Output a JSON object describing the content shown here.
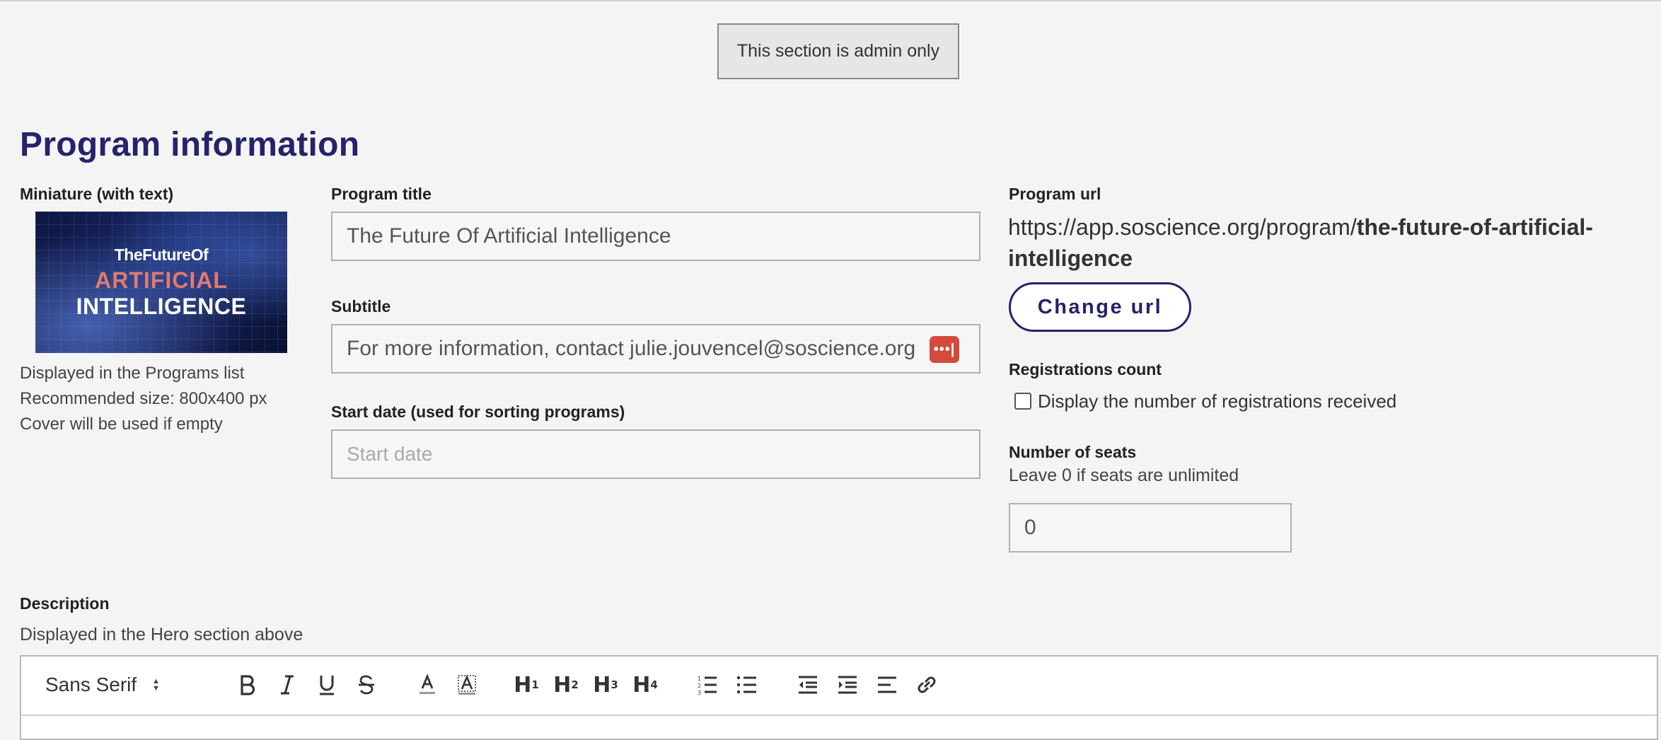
{
  "admin_banner": "This section is admin only",
  "section_title": "Program information",
  "miniature": {
    "label": "Miniature (with text)",
    "image_line1": "TheFutureOf",
    "image_line2": "ARTIFICIAL",
    "image_line3": "INTELLIGENCE",
    "help": [
      "Displayed in the Programs list",
      "Recommended size: 800x400 px",
      "Cover will be used if empty"
    ]
  },
  "program_title": {
    "label": "Program title",
    "value": "The Future Of Artificial Intelligence"
  },
  "subtitle": {
    "label": "Subtitle",
    "value": "For more information, contact julie.jouvencel@soscience.org"
  },
  "start_date": {
    "label": "Start date (used for sorting programs)",
    "placeholder": "Start date"
  },
  "program_url": {
    "label": "Program url",
    "prefix": "https://app.soscience.org/program/",
    "slug": "the-future-of-artificial-intelligence",
    "change_button": "Change url"
  },
  "registrations": {
    "label": "Registrations count",
    "checkbox_label": "Display the number of registrations received",
    "checked": false
  },
  "seats": {
    "label": "Number of seats",
    "help": "Leave 0 if seats are unlimited",
    "value": "0"
  },
  "description": {
    "label": "Description",
    "help": "Displayed in the Hero section above",
    "toolbar": {
      "font": "Sans Serif",
      "icons": [
        "bold-icon",
        "italic-icon",
        "underline-icon",
        "strike-icon",
        "text-color-icon",
        "background-color-icon",
        "h1-icon",
        "h2-icon",
        "h3-icon",
        "h4-icon",
        "ordered-list-icon",
        "bullet-list-icon",
        "outdent-icon",
        "indent-icon",
        "align-icon",
        "link-icon"
      ],
      "h1": "H",
      "h2": "H",
      "h3": "H",
      "h4": "H",
      "h1_sub": "1",
      "h2_sub": "2",
      "h3_sub": "3",
      "h4_sub": "4"
    }
  }
}
